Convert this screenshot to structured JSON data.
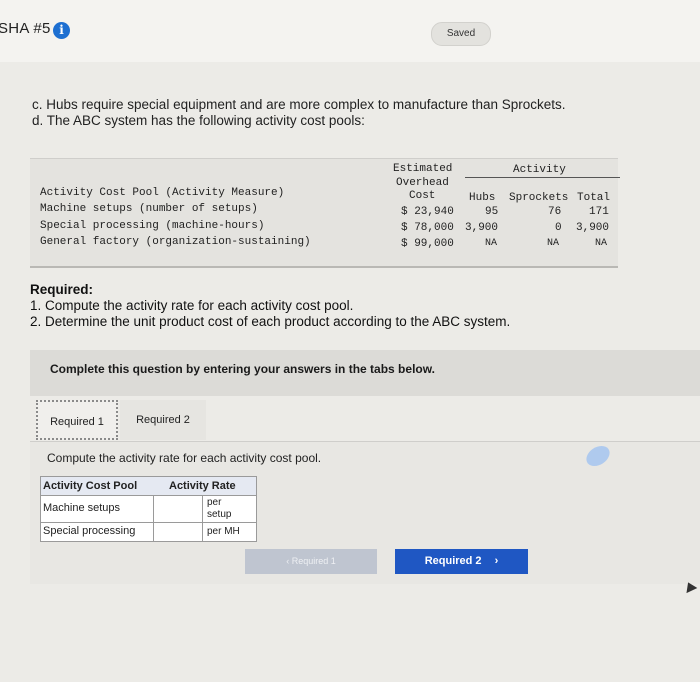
{
  "header": {
    "title": "SHA #5",
    "info_icon": "info-icon",
    "saved": "Saved"
  },
  "intro": [
    "c. Hubs require special equipment and are more complex to manufacture than Sprockets.",
    "d. The ABC system has the following activity cost pools:"
  ],
  "cost_table": {
    "estimated_header": [
      "Estimated",
      "Overhead",
      "Cost"
    ],
    "activity_header": "Activity",
    "columns": [
      "Hubs",
      "Sprockets",
      "Total"
    ],
    "pool_header": "Activity Cost Pool (Activity Measure)",
    "rows": [
      {
        "pool": "Machine setups (number of setups)",
        "cost": "$ 23,940",
        "hubs": "95",
        "sprockets": "76",
        "total": "171"
      },
      {
        "pool": "Special processing (machine-hours)",
        "cost": "$ 78,000",
        "hubs": "3,900",
        "sprockets": "0",
        "total": "3,900"
      },
      {
        "pool": "General factory (organization-sustaining)",
        "cost": "$ 99,000",
        "hubs": "NA",
        "sprockets": "NA",
        "total": "NA"
      }
    ]
  },
  "required": {
    "heading": "Required:",
    "items": [
      "1. Compute the activity rate for each activity cost pool.",
      "2. Determine the unit product cost of each product according to the ABC system."
    ]
  },
  "banner": "Complete this question by entering your answers in the tabs below.",
  "tabs": [
    "Required 1",
    "Required 2"
  ],
  "instruction": "Compute the activity rate for each activity cost pool.",
  "answer_table": {
    "headers": [
      "Activity Cost Pool",
      "Activity Rate"
    ],
    "rows": [
      {
        "pool": "Machine setups",
        "value": "",
        "unit_line1": "per",
        "unit_line2": "setup"
      },
      {
        "pool": "Special processing",
        "value": "",
        "unit_line1": "per MH",
        "unit_line2": ""
      }
    ]
  },
  "nav": {
    "prev": "Required 1",
    "next": "Required 2",
    "prev_icon": "chevron-left-icon",
    "next_icon": "chevron-right-icon"
  }
}
